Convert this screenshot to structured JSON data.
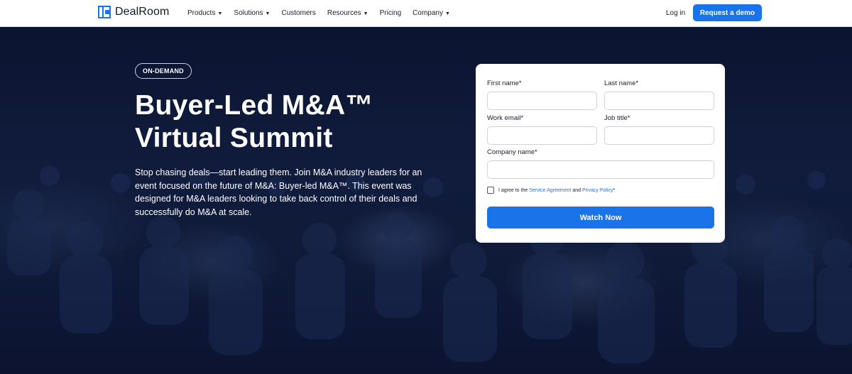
{
  "nav": {
    "logo_text": "DealRoom",
    "menu": [
      {
        "label": "Products",
        "has_dropdown": true
      },
      {
        "label": "Solutions",
        "has_dropdown": true
      },
      {
        "label": "Customers",
        "has_dropdown": false
      },
      {
        "label": "Resources",
        "has_dropdown": true
      },
      {
        "label": "Pricing",
        "has_dropdown": false
      },
      {
        "label": "Company",
        "has_dropdown": true
      }
    ],
    "login_label": "Log in",
    "demo_label": "Request a demo"
  },
  "hero": {
    "badge": "ON-DEMAND",
    "title_line1": "Buyer-Led M&A™",
    "title_line2": "Virtual Summit",
    "description": "Stop chasing deals—start leading them.  Join M&A industry leaders for an event focused on the future of M&A: Buyer-led M&A™.  This event was designed for M&A leaders looking to take back control of their deals and successfully do M&A at scale."
  },
  "form": {
    "first_name_label": "First name*",
    "last_name_label": "Last name*",
    "work_email_label": "Work email*",
    "job_title_label": "Job title*",
    "company_name_label": "Company name*",
    "agree_prefix": "I agree to the",
    "service_agreement_link": "Service Agreement",
    "and_text": "and",
    "privacy_policy_link": "Privacy Policy",
    "agree_suffix": "*",
    "submit_label": "Watch Now"
  },
  "colors": {
    "accent": "#1a73e8",
    "hero_bg": "#0f1a38",
    "nav_bg": "#ffffff"
  }
}
